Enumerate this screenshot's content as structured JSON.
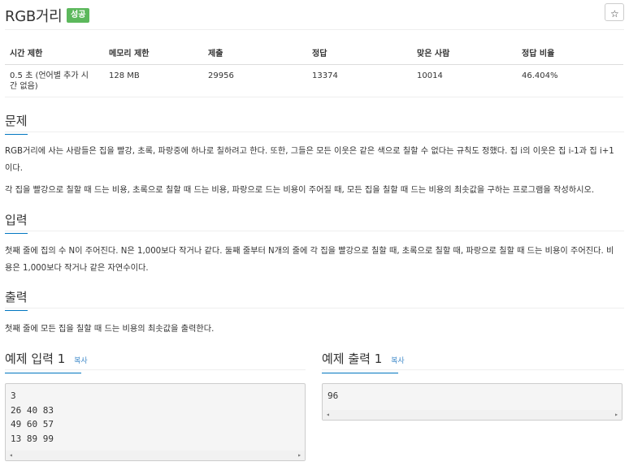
{
  "problem": {
    "title": "RGB거리",
    "badge": "성공",
    "star": "☆"
  },
  "info_table": {
    "headers": [
      "시간 제한",
      "메모리 제한",
      "제출",
      "정답",
      "맞은 사람",
      "정답 비율"
    ],
    "row": [
      "0.5 초 (언어별 추가 시간 없음)",
      "128 MB",
      "29956",
      "13374",
      "10014",
      "46.404%"
    ]
  },
  "sections": {
    "problem": {
      "heading": "문제",
      "paragraphs": [
        "RGB거리에 사는 사람들은 집을 빨강, 초록, 파랑중에 하나로 칠하려고 한다. 또한, 그들은 모든 이웃은 같은 색으로 칠할 수 없다는 규칙도 정했다. 집 i의 이웃은 집 i-1과 집 i+1이다.",
        "각 집을 빨강으로 칠할 때 드는 비용, 초록으로 칠할 때 드는 비용, 파랑으로 드는 비용이 주어질 때, 모든 집을 칠할 때 드는 비용의 최솟값을 구하는 프로그램을 작성하시오."
      ]
    },
    "input": {
      "heading": "입력",
      "paragraph": "첫째 줄에 집의 수 N이 주어진다. N은 1,000보다 작거나 같다. 둘째 줄부터 N개의 줄에 각 집을 빨강으로 칠할 때, 초록으로 칠할 때, 파랑으로 칠할 때 드는 비용이 주어진다. 비용은 1,000보다 작거나 같은 자연수이다."
    },
    "output": {
      "heading": "출력",
      "paragraph": "첫째 줄에 모든 집을 칠할 때 드는 비용의 최솟값을 출력한다."
    }
  },
  "samples": {
    "input": {
      "label": "예제 입력",
      "number": "1",
      "copy": "복사",
      "lines": [
        "3",
        "26 40 83",
        "49 60 57",
        "13 89 99"
      ]
    },
    "output": {
      "label": "예제 출력",
      "number": "1",
      "copy": "복사",
      "lines": [
        "96"
      ]
    }
  },
  "scroll_arrows": {
    "left": "◂",
    "right": "▸"
  },
  "colors": {
    "accent": "#0076c0",
    "success": "#5cb85c",
    "link": "#428bca"
  }
}
